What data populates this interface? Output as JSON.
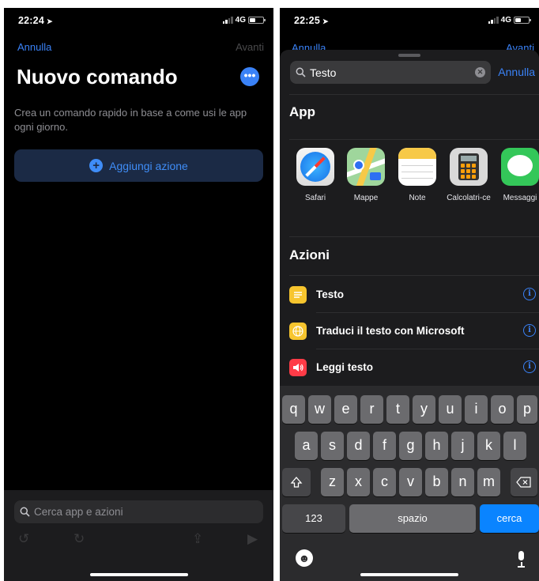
{
  "left": {
    "status": {
      "time": "22:24",
      "network": "4G"
    },
    "nav": {
      "cancel": "Annulla",
      "next": "Avanti"
    },
    "title": "Nuovo comando",
    "more_label": "•••",
    "description": "Crea un comando rapido in base a come usi le app ogni giorno.",
    "add_action": "Aggiungi azione",
    "search_placeholder": "Cerca app e azioni"
  },
  "right": {
    "status": {
      "time": "22:25",
      "network": "4G"
    },
    "behind_nav": {
      "cancel": "Annulla",
      "next": "Avanti"
    },
    "search": {
      "value": "Testo",
      "cancel": "Annulla"
    },
    "apps_section": "App",
    "apps": [
      {
        "label": "Safari",
        "icon": "safari-icon"
      },
      {
        "label": "Mappe",
        "icon": "maps-icon"
      },
      {
        "label": "Note",
        "icon": "notes-icon"
      },
      {
        "label": "Calcolatri-ce",
        "icon": "calculator-icon"
      },
      {
        "label": "Messaggi",
        "icon": "messages-icon"
      }
    ],
    "actions_section": "Azioni",
    "actions": [
      {
        "label": "Testo",
        "icon": "text-icon",
        "color": "#f7c52e"
      },
      {
        "label": "Traduci il testo con Microsoft",
        "icon": "globe-icon",
        "color": "#f7c52e"
      },
      {
        "label": "Leggi testo",
        "icon": "speaker-icon",
        "color": "#ff3b47"
      }
    ],
    "keyboard": {
      "row1": [
        "q",
        "w",
        "e",
        "r",
        "t",
        "y",
        "u",
        "i",
        "o",
        "p"
      ],
      "row2": [
        "a",
        "s",
        "d",
        "f",
        "g",
        "h",
        "j",
        "k",
        "l"
      ],
      "row3": [
        "z",
        "x",
        "c",
        "v",
        "b",
        "n",
        "m"
      ],
      "numbers": "123",
      "space": "spazio",
      "search": "cerca"
    }
  },
  "colors": {
    "accent": "#3a82f7",
    "background": "#000000",
    "sheet": "#1c1c1e"
  }
}
